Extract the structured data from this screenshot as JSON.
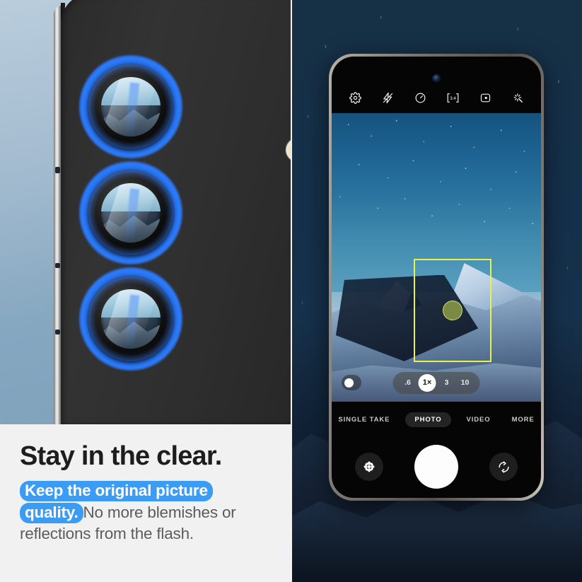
{
  "marketing": {
    "headline": "Stay in the clear.",
    "subcopy_highlight": "Keep the original picture quality.",
    "subcopy_rest": "No more blemishes or reflections from the flash.",
    "highlight_color": "#3b9cf5",
    "headline_color": "#1d1d1d",
    "body_color": "#5c5c5c"
  },
  "left_panel": {
    "scene": "close-up of phone rear camera lenses with blue protector rings",
    "lens_ring_color": "#2e7eff",
    "phone_body_color": "#2e2e2e",
    "background_color": "#a4bcd0",
    "lenses": [
      {
        "label": "wide-lens"
      },
      {
        "label": "ultrawide-lens"
      },
      {
        "label": "telephoto-lens"
      }
    ],
    "flash_label": "flash-led"
  },
  "right_panel": {
    "backdrop": "snowy mountains at night with falling snow",
    "backdrop_color": "#16314b",
    "device_frame_color": "#8e8881"
  },
  "camera_app": {
    "topbar": [
      {
        "name": "settings-icon",
        "glyph": "gear"
      },
      {
        "name": "flash-off-icon",
        "glyph": "flash-off"
      },
      {
        "name": "timer-icon",
        "glyph": "timer"
      },
      {
        "name": "aspect-ratio-icon",
        "glyph": "3:4",
        "label": "3:4"
      },
      {
        "name": "motion-photo-icon",
        "glyph": "motion"
      },
      {
        "name": "filters-icon",
        "glyph": "sparkle"
      }
    ],
    "focus": {
      "box_color": "#e8f24a",
      "indicator_color": "#c8dc50"
    },
    "zoom": {
      "selected": "1x",
      "levels": [
        {
          "label": ".6",
          "active": false
        },
        {
          "label": "1×",
          "active": true
        },
        {
          "label": "3",
          "active": false
        },
        {
          "label": "10",
          "active": false
        }
      ],
      "lens_toggle": "lens-toggle"
    },
    "modes": [
      {
        "label": "SINGLE TAKE",
        "active": false
      },
      {
        "label": "PHOTO",
        "active": true
      },
      {
        "label": "VIDEO",
        "active": false
      },
      {
        "label": "MORE",
        "active": false
      }
    ],
    "controls": {
      "gallery": "gallery-thumbnail",
      "shutter": "shutter-button",
      "switch_camera": "switch-camera-button"
    }
  }
}
